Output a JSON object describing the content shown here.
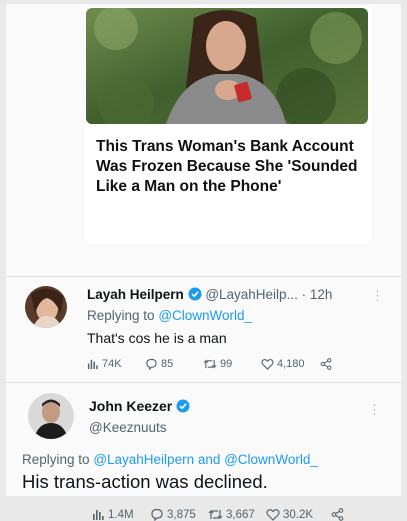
{
  "article": {
    "headline": "This Trans Woman's Bank Account Was Frozen Because She 'Sounded Like a Man on the Phone'",
    "stats": {
      "views": "1.4M",
      "replies": "3,875",
      "retweets": "3,667",
      "likes": "30.2K"
    }
  },
  "reply1": {
    "display_name": "Layah Heilpern",
    "handle": "@LayahHeilp...",
    "time": "· 12h",
    "replying_prefix": "Replying to",
    "replying_to": "@ClownWorld_",
    "text": "That's cos he is a man",
    "stats": {
      "views": "74K",
      "replies": "85",
      "retweets": "99",
      "likes": "4,180"
    }
  },
  "reply2": {
    "display_name": "John Keezer",
    "handle": "@Keeznuuts",
    "replying_prefix": "Replying to",
    "replying_to": "@LayahHeilpern and @ClownWorld_",
    "text": "His trans-action was declined."
  },
  "colors": {
    "accent": "#1d9bf0",
    "muted": "#536471",
    "text": "#0f1419"
  }
}
